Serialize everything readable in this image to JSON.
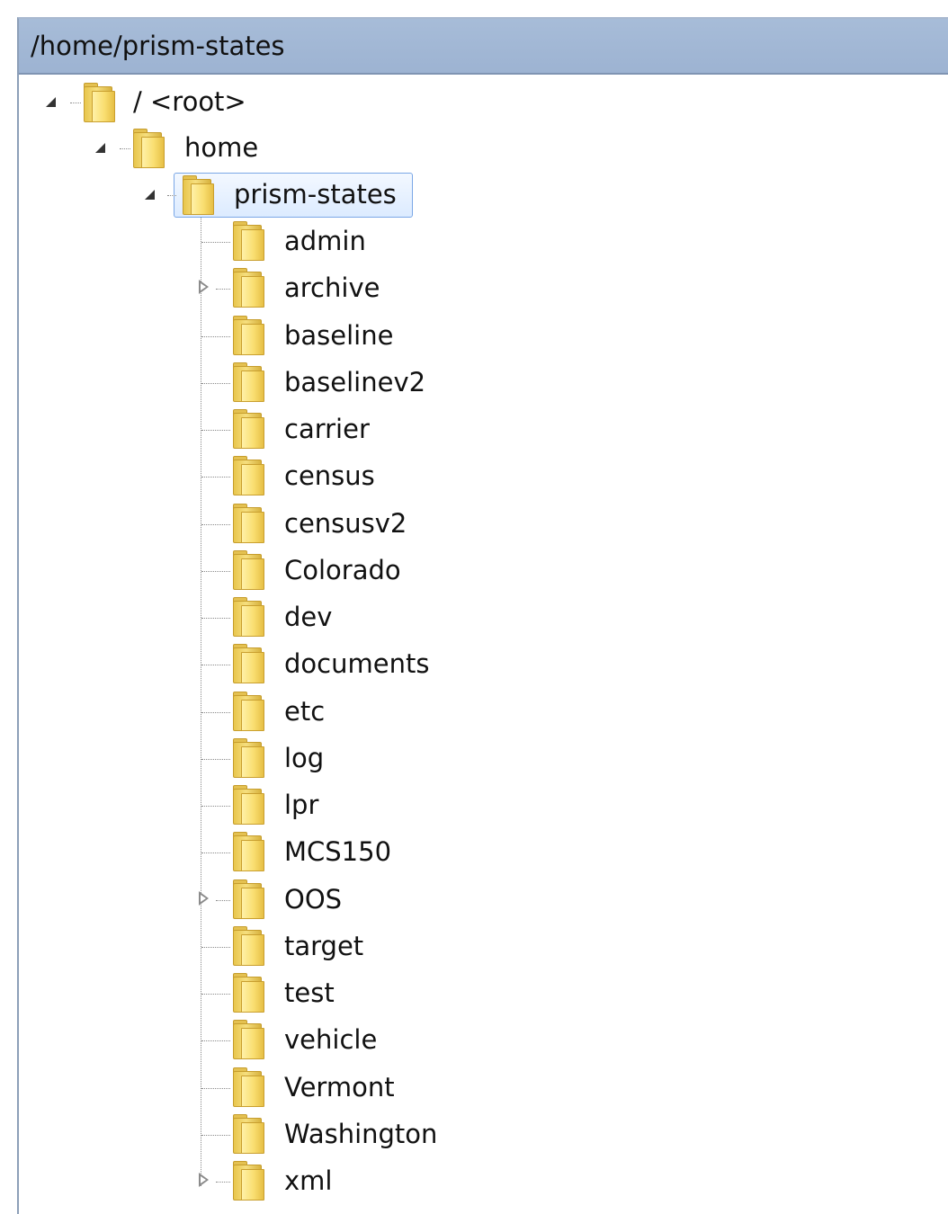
{
  "header": {
    "title": "/home/prism-states"
  },
  "tree": {
    "root_label": "/ <root>",
    "home_label": "home",
    "prism_label": "prism-states",
    "children": [
      {
        "label": "admin",
        "state": "leaf"
      },
      {
        "label": "archive",
        "state": "collapsed"
      },
      {
        "label": "baseline",
        "state": "leaf"
      },
      {
        "label": "baselinev2",
        "state": "leaf"
      },
      {
        "label": "carrier",
        "state": "leaf"
      },
      {
        "label": "census",
        "state": "leaf"
      },
      {
        "label": "censusv2",
        "state": "leaf"
      },
      {
        "label": "Colorado",
        "state": "leaf"
      },
      {
        "label": "dev",
        "state": "leaf"
      },
      {
        "label": "documents",
        "state": "leaf"
      },
      {
        "label": "etc",
        "state": "leaf"
      },
      {
        "label": "log",
        "state": "leaf"
      },
      {
        "label": "lpr",
        "state": "leaf"
      },
      {
        "label": "MCS150",
        "state": "leaf"
      },
      {
        "label": "OOS",
        "state": "collapsed"
      },
      {
        "label": "target",
        "state": "leaf"
      },
      {
        "label": "test",
        "state": "leaf"
      },
      {
        "label": "vehicle",
        "state": "leaf"
      },
      {
        "label": "Vermont",
        "state": "leaf"
      },
      {
        "label": "Washington",
        "state": "leaf"
      },
      {
        "label": "xml",
        "state": "collapsed"
      }
    ]
  },
  "icons": {
    "folder": "folder-icon",
    "expanded": "expanded-triangle-icon",
    "collapsed": "collapsed-triangle-icon"
  },
  "colors": {
    "header_bg": "#a7bcd8",
    "selection_border": "#7aa7e6",
    "folder_yellow": "#f9de70"
  }
}
